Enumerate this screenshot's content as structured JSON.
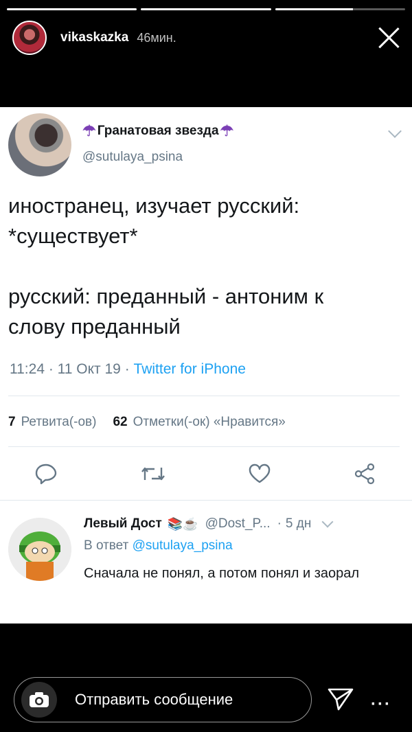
{
  "story": {
    "progress": [
      1.0,
      1.0,
      0.6
    ],
    "username": "vikaskazka",
    "time": "46мин."
  },
  "tweet": {
    "display_name": "Гранатовая звезда",
    "name_emoji": "☂",
    "handle": "@sutulaya_psina",
    "text": "иностранец, изучает русский:\n*существует*\n\nрусский: преданный - антоним к\nслову преданный",
    "time": "11:24 · 11 Окт 19 ·",
    "source": "Twitter for iPhone",
    "retweet_count": "7",
    "retweet_label": "Ретвита(-ов)",
    "like_count": "62",
    "like_label": "Отметки(-ок) «Нравится»"
  },
  "reply": {
    "name": "Левый Дост",
    "emoji": "📚☕",
    "handle": "@Dost_P...",
    "dot": "·",
    "time": "5 дн",
    "reply_prefix": "В ответ",
    "reply_to": "@sutulaya_psina",
    "text": "Сначала не понял, а потом понял и заорал"
  },
  "message_bar": {
    "placeholder": "Отправить сообщение",
    "more": "···"
  },
  "colors": {
    "link": "#1da1f2",
    "muted": "#657786",
    "umbrella": "#7b3fb5"
  }
}
